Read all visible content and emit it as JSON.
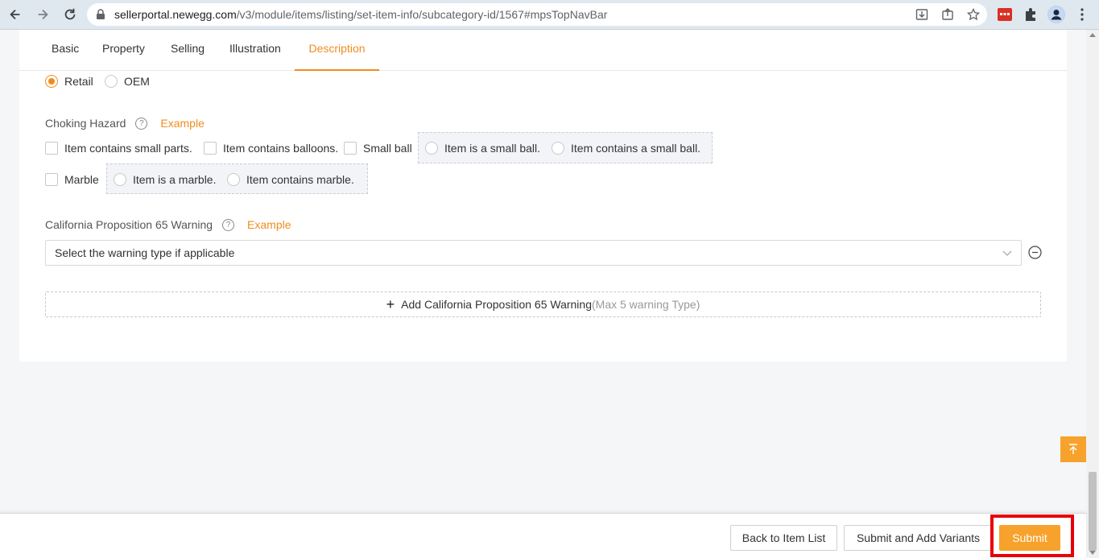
{
  "browser": {
    "url_host": "sellerportal.newegg.com",
    "url_path": "/v3/module/items/listing/set-item-info/subcategory-id/1567#mpsTopNavBar"
  },
  "tabs": [
    {
      "label": "Basic",
      "active": false
    },
    {
      "label": "Property",
      "active": false
    },
    {
      "label": "Selling",
      "active": false
    },
    {
      "label": "Illustration",
      "active": false
    },
    {
      "label": "Description",
      "active": true
    }
  ],
  "packaging": {
    "options": [
      {
        "label": "Retail",
        "selected": true
      },
      {
        "label": "OEM",
        "selected": false
      }
    ]
  },
  "choking_hazard": {
    "label": "Choking Hazard",
    "example": "Example",
    "checkboxes": {
      "small_parts": "Item contains small parts.",
      "balloons": "Item contains balloons.",
      "small_ball": "Small ball",
      "marble": "Marble"
    },
    "small_ball_options": [
      "Item is a small ball.",
      "Item contains a small ball."
    ],
    "marble_options": [
      "Item is a marble.",
      "Item contains marble."
    ]
  },
  "prop65": {
    "label": "California Proposition 65 Warning",
    "example": "Example",
    "select_placeholder": "Select the warning type if applicable",
    "add_label": "Add California Proposition 65 Warning",
    "add_hint": "(Max 5 warning Type)"
  },
  "footer": {
    "back": "Back to Item List",
    "submit_variants": "Submit and Add Variants",
    "submit": "Submit"
  },
  "colors": {
    "accent": "#f08c1e",
    "primary_button": "#f7a22c",
    "highlight": "#e8000b"
  }
}
